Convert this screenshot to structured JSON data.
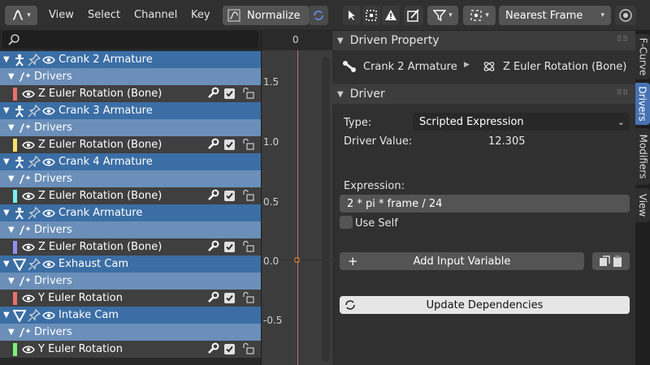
{
  "header": {
    "menus": [
      "View",
      "Select",
      "Channel",
      "Key"
    ],
    "normalize_label": "Normalize",
    "pivot_label": "Nearest Frame"
  },
  "channels": [
    {
      "kind": "obj",
      "label": "Crank 2 Armature",
      "icon": "armature-icon"
    },
    {
      "kind": "grp",
      "label": "Drivers"
    },
    {
      "kind": "fc",
      "label": "Z Euler Rotation (Bone)",
      "color": "#e8706b"
    },
    {
      "kind": "obj",
      "label": "Crank 3 Armature",
      "icon": "armature-icon"
    },
    {
      "kind": "grp",
      "label": "Drivers"
    },
    {
      "kind": "fc",
      "label": "Z Euler Rotation (Bone)",
      "color": "#f2e26b"
    },
    {
      "kind": "obj",
      "label": "Crank 4 Armature",
      "icon": "armature-icon"
    },
    {
      "kind": "grp",
      "label": "Drivers"
    },
    {
      "kind": "fc",
      "label": "Z Euler Rotation (Bone)",
      "color": "#78f0ec"
    },
    {
      "kind": "obj",
      "label": "Crank Armature",
      "icon": "armature-icon"
    },
    {
      "kind": "grp",
      "label": "Drivers"
    },
    {
      "kind": "fc",
      "label": "Z Euler Rotation (Bone)",
      "color": "#8f8ff0"
    },
    {
      "kind": "obj",
      "label": "Exhaust Cam",
      "icon": "mesh-icon"
    },
    {
      "kind": "grp",
      "label": "Drivers"
    },
    {
      "kind": "fc",
      "label": "Y Euler Rotation",
      "color": "#e8706b"
    },
    {
      "kind": "obj",
      "label": "Intake Cam",
      "icon": "mesh-icon"
    },
    {
      "kind": "grp",
      "label": "Drivers"
    },
    {
      "kind": "fc",
      "label": "Y Euler Rotation",
      "color": "#7ef07a"
    }
  ],
  "graph": {
    "frame_label": "0",
    "y_labels": [
      "1.5",
      "1.0",
      "0.5",
      "0.0",
      "-0.5"
    ]
  },
  "driven_property": {
    "title": "Driven Property",
    "object": "Crank 2 Armature",
    "property": "Z Euler Rotation (Bone)"
  },
  "driver": {
    "title": "Driver",
    "type_label": "Type:",
    "type_value": "Scripted Expression",
    "value_label": "Driver Value:",
    "value": "12.305",
    "expression_label": "Expression:",
    "expression": "2 * pi * frame / 24",
    "use_self_label": "Use Self",
    "add_variable_label": "Add Input Variable",
    "update_label": "Update Dependencies"
  },
  "tabs": [
    "F-Curve",
    "Drivers",
    "Modifiers",
    "View"
  ]
}
